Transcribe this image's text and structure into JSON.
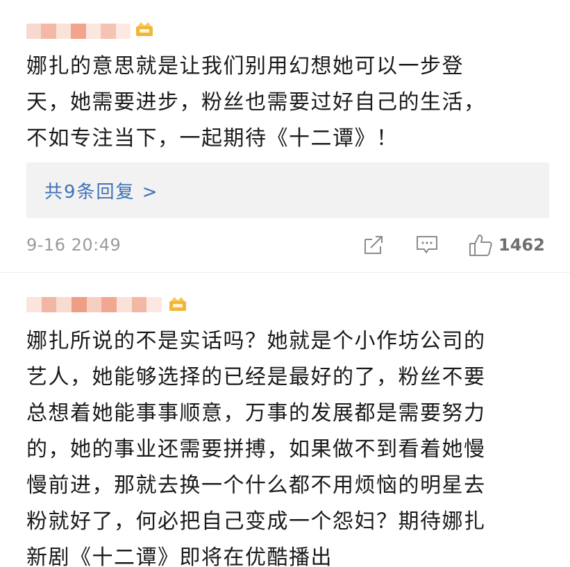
{
  "comments": [
    {
      "text": "娜扎的意思就是让我们别用幻想她可以一步登\n天，她需要进步，粉丝也需要过好自己的生活，\n不如专注当下，一起期待《十二谭》！",
      "replies_label": "共9条回复 >",
      "timestamp": "9-16 20:49",
      "likes": "1462",
      "icons": [
        "share-icon",
        "comment-icon",
        "like-icon"
      ]
    },
    {
      "text": "娜扎所说的不是实话吗？她就是个小作坊公司的\n艺人，她能够选择的已经是最好的了，粉丝不要\n总想着她能事事顺意，万事的发展都是需要努力\n的，她的事业还需要拼搏，如果做不到看着她慢\n慢前进，那就去换一个什么都不用烦恼的明星去\n粉就好了，何必把自己变成一个怨妇？期待娜扎\n新剧《十二谭》即将在优酷播出"
    }
  ],
  "colors": {
    "link": "#3f72b8",
    "meta": "#9a9a9a",
    "replies_bg": "#f2f2f2",
    "badge": "#f2b637"
  }
}
